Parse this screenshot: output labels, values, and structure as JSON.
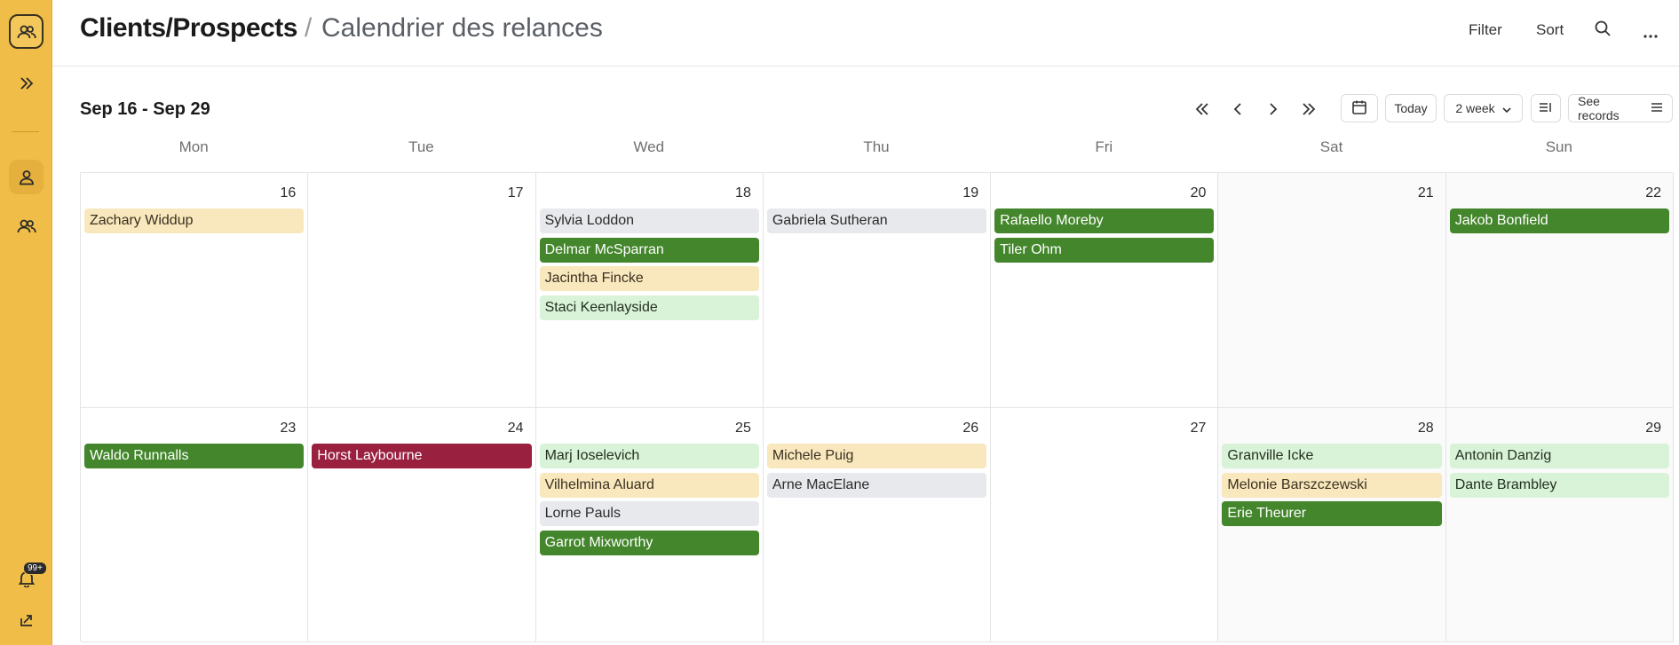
{
  "header": {
    "app_name": "Clients/Prospects",
    "separator": "/",
    "view_name": "Calendrier des relances",
    "filter_label": "Filter",
    "sort_label": "Sort"
  },
  "rail": {
    "notification_badge": "99+"
  },
  "toolbar": {
    "range_title": "Sep 16 - Sep 29",
    "today_label": "Today",
    "period_label": "2 week",
    "see_records_label": "See records"
  },
  "weekdays": [
    "Mon",
    "Tue",
    "Wed",
    "Thu",
    "Fri",
    "Sat",
    "Sun"
  ],
  "colors": {
    "rail": "#efbd48",
    "event_grey": "#e7e9ec",
    "event_yellow": "#f9e8bd",
    "event_light_green": "#d9f3d8",
    "event_green": "#43862b",
    "event_red": "#9a2040"
  },
  "weeks": [
    {
      "days": [
        {
          "num": "16",
          "events": [
            {
              "name": "Zachary Widdup",
              "color": "yellow"
            }
          ]
        },
        {
          "num": "17",
          "events": []
        },
        {
          "num": "18",
          "events": [
            {
              "name": "Sylvia Loddon",
              "color": "grey"
            },
            {
              "name": "Delmar McSparran",
              "color": "green"
            },
            {
              "name": "Jacintha Fincke",
              "color": "yellow"
            },
            {
              "name": "Staci Keenlayside",
              "color": "lightgreen"
            }
          ]
        },
        {
          "num": "19",
          "events": [
            {
              "name": "Gabriela Sutheran",
              "color": "grey"
            }
          ]
        },
        {
          "num": "20",
          "events": [
            {
              "name": "Rafaello Moreby",
              "color": "green"
            },
            {
              "name": "Tiler Ohm",
              "color": "green"
            }
          ]
        },
        {
          "num": "21",
          "events": []
        },
        {
          "num": "22",
          "events": [
            {
              "name": "Jakob Bonfield",
              "color": "green"
            }
          ]
        }
      ]
    },
    {
      "days": [
        {
          "num": "23",
          "events": [
            {
              "name": "Waldo Runnalls",
              "color": "green"
            }
          ]
        },
        {
          "num": "24",
          "events": [
            {
              "name": "Horst Laybourne",
              "color": "red"
            }
          ]
        },
        {
          "num": "25",
          "events": [
            {
              "name": "Marj Ioselevich",
              "color": "lightgreen"
            },
            {
              "name": "Vilhelmina Aluard",
              "color": "yellow"
            },
            {
              "name": "Lorne Pauls",
              "color": "grey"
            },
            {
              "name": "Garrot Mixworthy",
              "color": "green"
            }
          ]
        },
        {
          "num": "26",
          "events": [
            {
              "name": "Michele Puig",
              "color": "yellow"
            },
            {
              "name": "Arne MacElane",
              "color": "grey"
            }
          ]
        },
        {
          "num": "27",
          "events": []
        },
        {
          "num": "28",
          "events": [
            {
              "name": "Granville Icke",
              "color": "lightgreen"
            },
            {
              "name": "Melonie Barszczewski",
              "color": "yellow"
            },
            {
              "name": "Erie Theurer",
              "color": "green"
            }
          ]
        },
        {
          "num": "29",
          "events": [
            {
              "name": "Antonin Danzig",
              "color": "lightgreen"
            },
            {
              "name": "Dante Brambley",
              "color": "lightgreen"
            }
          ]
        }
      ]
    }
  ]
}
